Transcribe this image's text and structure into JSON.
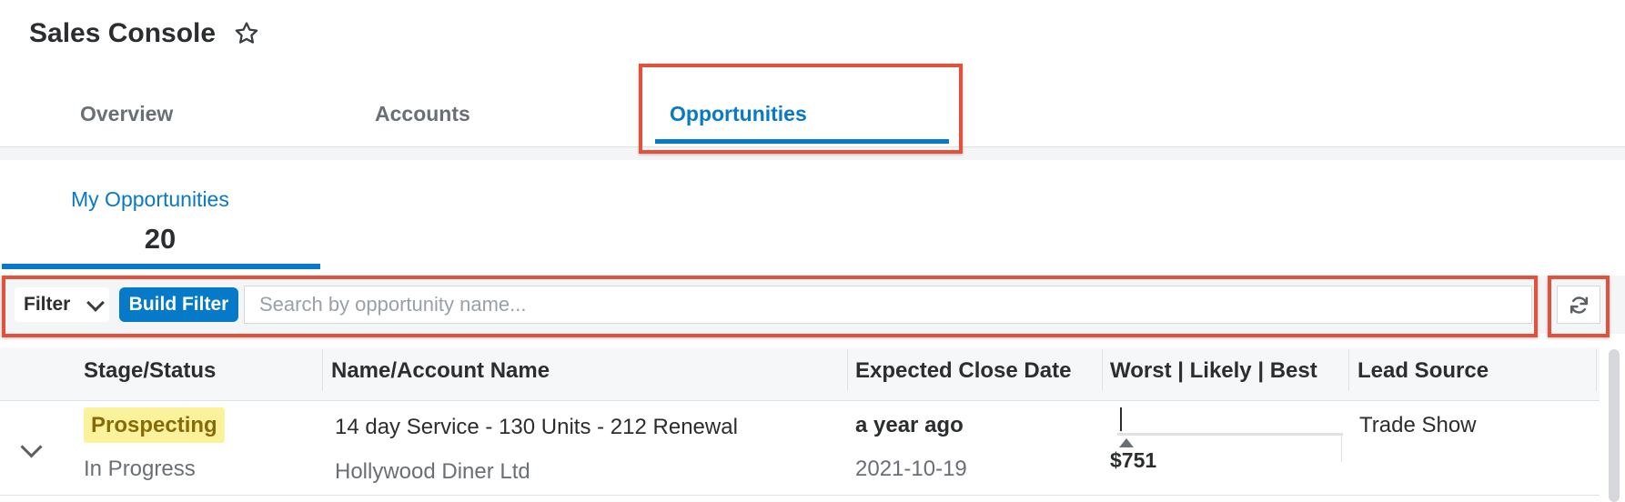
{
  "header": {
    "title": "Sales Console",
    "favorite_icon": "star-outline-icon"
  },
  "tabs": [
    {
      "label": "Overview",
      "active": false
    },
    {
      "label": "Accounts",
      "active": false
    },
    {
      "label": "Opportunities",
      "active": true
    }
  ],
  "dashlet": {
    "label": "My Opportunities",
    "count": "20"
  },
  "filter_bar": {
    "filter_label": "Filter",
    "build_filter_label": "Build Filter",
    "search_placeholder": "Search by opportunity name...",
    "refresh_icon": "refresh-icon"
  },
  "table": {
    "columns": [
      "Stage/Status",
      "Name/Account Name",
      "Expected Close Date",
      "Worst | Likely | Best",
      "Lead Source"
    ],
    "rows": [
      {
        "stage": "Prospecting",
        "status": "In Progress",
        "name": "14 day Service - 130 Units - 212 Renewal",
        "account": "Hollywood Diner Ltd",
        "close_relative": "a year ago",
        "close_date": "2021-10-19",
        "likely": "$751",
        "lead_source": "Trade Show"
      }
    ]
  },
  "colors": {
    "accent": "#0679c8",
    "highlight": "#e2513c",
    "badge_bg": "#fbf39b"
  }
}
